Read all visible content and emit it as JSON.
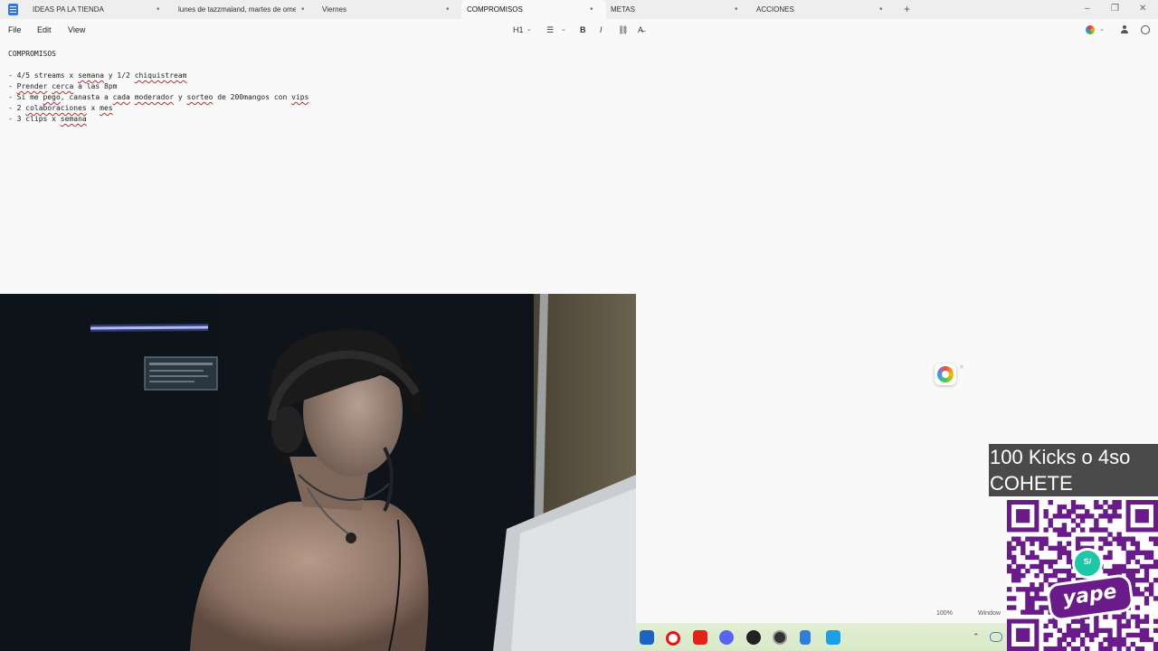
{
  "tabs": [
    {
      "label": "IDEAS PA LA TIENDA"
    },
    {
      "label": "lunes de tazzmaland, martes de ome"
    },
    {
      "label": "Viernes"
    },
    {
      "label": "COMPROMISOS",
      "active": true
    },
    {
      "label": "METAS"
    },
    {
      "label": "ACCIONES"
    }
  ],
  "tab_close_glyph": "•",
  "new_tab_glyph": "+",
  "window_controls": {
    "minimize": "–",
    "maximize": "❐",
    "close": "✕"
  },
  "menu": [
    "File",
    "Edit",
    "View"
  ],
  "toolbar": {
    "heading": "H1",
    "chevron": "⌄",
    "list": "☰",
    "bold": "B",
    "italic": "I",
    "link": "⛓",
    "clear": "A̶"
  },
  "document": {
    "title": "COMPROMISOS",
    "lines": [
      [
        {
          "t": "- 4/5 streams x "
        },
        {
          "t": "semana",
          "e": 1
        },
        {
          "t": " y 1/2 "
        },
        {
          "t": "chiquistream",
          "e": 1
        }
      ],
      [
        {
          "t": "- "
        },
        {
          "t": "Prender",
          "e": 1
        },
        {
          "t": " "
        },
        {
          "t": "cerca",
          "e": 1
        },
        {
          "t": " a las 8pm"
        }
      ],
      [
        {
          "t": "- Si me "
        },
        {
          "t": "pego",
          "e": 1
        },
        {
          "t": ", canasta a "
        },
        {
          "t": "cada",
          "e": 1
        },
        {
          "t": " "
        },
        {
          "t": "moderador",
          "e": 1
        },
        {
          "t": " y "
        },
        {
          "t": "sorteo",
          "e": 1
        },
        {
          "t": " de 200mangos con "
        },
        {
          "t": "vips",
          "e": 1
        }
      ],
      [
        {
          "t": "- 2 "
        },
        {
          "t": "colaboraciones",
          "e": 1
        },
        {
          "t": " x "
        },
        {
          "t": "mes",
          "e": 1
        }
      ],
      [
        {
          "t": "- 3 clips x "
        },
        {
          "t": "semana",
          "e": 1
        }
      ]
    ]
  },
  "overlay": {
    "line1": "100 Kicks o 4so",
    "line2": "COHETE"
  },
  "qr": {
    "badge": "S/",
    "word": "yape"
  },
  "status": {
    "zoom": "100%",
    "platform": "Window"
  },
  "tray": {
    "chevron": "⌃"
  },
  "taskbar_icons": [
    "outlook-icon",
    "opera-icon",
    "wps-office-icon",
    "discord-icon",
    "obs-icon",
    "camera-app-icon",
    "notepad-icon",
    "snipping-tool-icon"
  ],
  "colors": {
    "accent": "#1a73e8",
    "spellcheck": "#dd2222",
    "overlay_bg": "#4a4a4a",
    "qr_purple": "#6a1b8a",
    "taskbar": "#dfeccf"
  }
}
